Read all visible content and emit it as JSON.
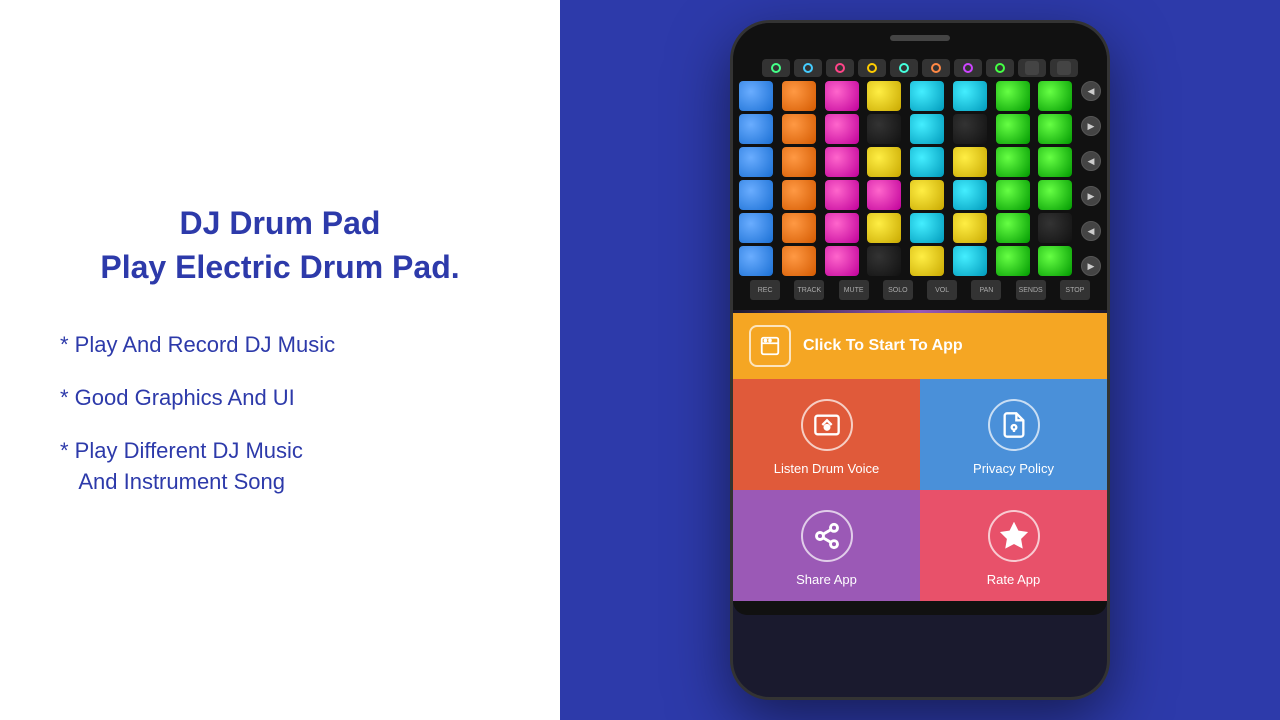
{
  "left": {
    "title_line1": "DJ Drum Pad",
    "title_line2": "Play Electric Drum Pad.",
    "features": [
      "* Play And Record DJ Music",
      "* Good Graphics And UI",
      "* Play Different DJ Music\n    And Instrument Song"
    ]
  },
  "phone": {
    "start_button": {
      "label": "Click To Start To App"
    },
    "menu_items": [
      {
        "label": "Listen Drum Voice",
        "color_class": "menu-listen"
      },
      {
        "label": "Privacy Policy",
        "color_class": "menu-privacy"
      },
      {
        "label": "Share App",
        "color_class": "menu-share"
      },
      {
        "label": "Rate App",
        "color_class": "menu-rate"
      }
    ]
  },
  "colors": {
    "background_blue": "#2d3aaa",
    "title_color": "#2d3aaa",
    "feature_color": "#2d3aaa"
  }
}
